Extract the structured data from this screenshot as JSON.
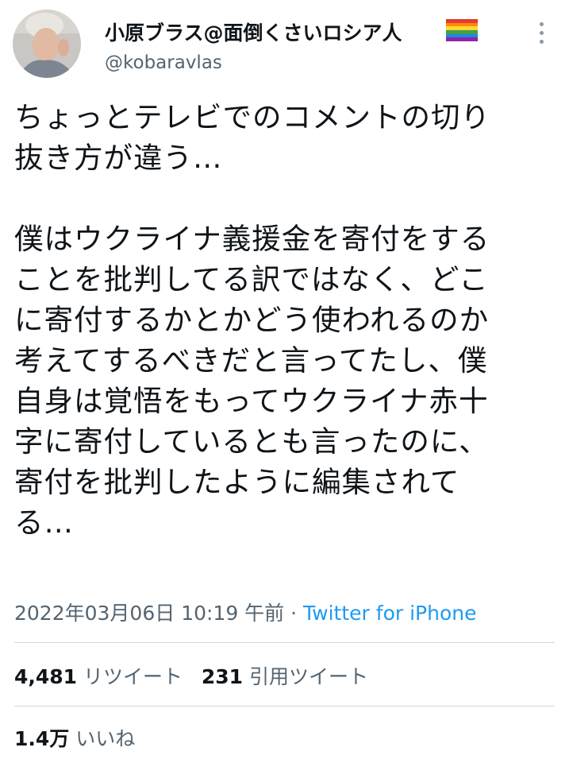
{
  "tweet": {
    "author": {
      "display_name": "小原ブラス@面倒くさいロシア人",
      "handle": "@kobaravlas",
      "name_emoji": "rainbow-flag-icon",
      "avatar_icon": "avatar"
    },
    "more_icon": "more-options-icon",
    "text": "ちょっとテレビでのコメントの切り\n抜き方が違う…\n\n僕はウクライナ義援金を寄付をする\nことを批判してる訳ではなく、どこ\nに寄付するかとかどう使われるのか\n考えてするべきだと言ってたし、僕\n自身は覚悟をもってウクライナ赤十\n字に寄付しているとも言ったのに、\n寄付を批判したように編集されて\nる…",
    "timestamp": "2022年03月06日 10:19 午前",
    "separator": " · ",
    "source": "Twitter for iPhone",
    "stats": {
      "retweets_count": "4,481",
      "retweets_label": "リツイート",
      "quotes_count": "231",
      "quotes_label": "引用ツイート",
      "likes_count": "1.4万",
      "likes_label": "いいね"
    },
    "colors": {
      "text": "#0f1419",
      "secondary": "#536471",
      "link": "#1d9bf0",
      "divider": "#cfd9de"
    }
  }
}
